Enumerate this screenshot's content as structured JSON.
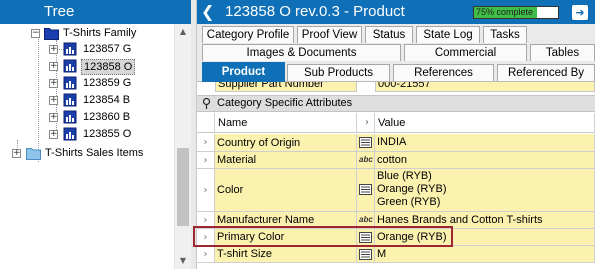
{
  "tree": {
    "title": "Tree",
    "items": [
      {
        "label": "T-Shirts Family",
        "expander": "−"
      },
      {
        "label": "123857 G",
        "expander": "+"
      },
      {
        "label": "123858 O",
        "expander": "+",
        "selected": true
      },
      {
        "label": "123859 G",
        "expander": "+"
      },
      {
        "label": "123854 B",
        "expander": "+"
      },
      {
        "label": "123860 B",
        "expander": "+"
      },
      {
        "label": "123855 O",
        "expander": "+"
      },
      {
        "label": "T-Shirts Sales Items",
        "expander": "+"
      }
    ]
  },
  "product": {
    "back_icon": "back-arrow-icon",
    "title": "123858 O rev.0.3 - Product",
    "progress_label": "75% complete",
    "progress_fraction": 0.75,
    "exit_icon": "exit-icon"
  },
  "tabs": {
    "row1": [
      "Category Profile",
      "Proof View",
      "Status",
      "State Log",
      "Tasks"
    ],
    "row2": [
      "Images & Documents",
      "Commercial",
      "Tables"
    ],
    "row3": [
      "Product",
      "Sub Products",
      "References",
      "Referenced By"
    ],
    "active": "Product"
  },
  "grid": {
    "cut_row_name": "Supplier Part Number",
    "cut_row_value": "000-21557",
    "group_title": "Category Specific Attributes",
    "headers": {
      "name": "Name",
      "value": "Value"
    },
    "rows": [
      {
        "name": "Country of Origin",
        "type": "list",
        "values": [
          "INDIA"
        ]
      },
      {
        "name": "Material",
        "type": "abc",
        "values": [
          "cotton"
        ]
      },
      {
        "name": "Color",
        "type": "list",
        "values": [
          "Blue (RYB)",
          "Orange (RYB)",
          "Green (RYB)"
        ]
      },
      {
        "name": "Manufacturer Name",
        "type": "abc",
        "values": [
          "Hanes Brands and Cotton T-shirts"
        ]
      },
      {
        "name": "Primary Color",
        "type": "list",
        "values": [
          "Orange (RYB)"
        ]
      },
      {
        "name": "T-shirt Size",
        "type": "list",
        "values": [
          "M"
        ]
      }
    ]
  },
  "colors": {
    "header_blue": "#0f70b8",
    "attribute_yellow": "#fbf2b0",
    "highlight_red": "#9c2731",
    "progress_green": "#3fbf47"
  }
}
